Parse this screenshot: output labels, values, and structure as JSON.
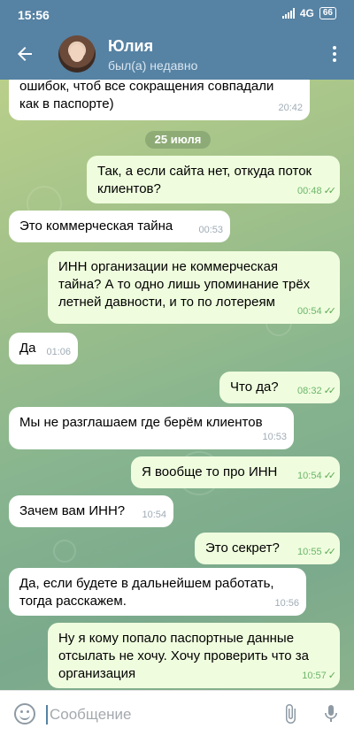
{
  "status_bar": {
    "time": "15:56",
    "network": "4G",
    "battery": "66"
  },
  "header": {
    "contact_name": "Юлия",
    "last_seen": "был(а) недавно"
  },
  "date_separator": "25 июля",
  "messages": [
    {
      "direction": "in",
      "text": "ошибок, чтоб все сокращения совпадали\nкак в паспорте)",
      "time": "20:42"
    },
    {
      "direction": "out",
      "text": "Так, а если сайта нет, откуда поток\nклиентов?",
      "time": "00:48",
      "read": true
    },
    {
      "direction": "in",
      "text": "Это коммерческая тайна",
      "time": "00:53"
    },
    {
      "direction": "out",
      "text": "ИНН организации не коммерческая\nтайна? А то одно лишь упоминание трёх\nлетней давности, и то по лотереям",
      "time": "00:54",
      "read": true
    },
    {
      "direction": "in",
      "text": "Да",
      "time": "01:06"
    },
    {
      "direction": "out",
      "text": "Что да?",
      "time": "08:32",
      "read": true
    },
    {
      "direction": "in",
      "text": "Мы не разглашаем где берём клиентов",
      "time": "10:53"
    },
    {
      "direction": "out",
      "text": "Я вообще то про ИНН",
      "time": "10:54",
      "read": true
    },
    {
      "direction": "in",
      "text": "Зачем вам ИНН?",
      "time": "10:54"
    },
    {
      "direction": "out",
      "text": "Это секрет?",
      "time": "10:55",
      "read": true
    },
    {
      "direction": "in",
      "text": "Да, если будете в дальнейшем работать,\nтогда расскажем.",
      "time": "10:56"
    },
    {
      "direction": "out",
      "text": "Ну я кому попало паспортные данные\nотсылать не хочу. Хочу проверить что за\nорганизация",
      "time": "10:57",
      "read": false
    }
  ],
  "input": {
    "placeholder": "Сообщение"
  },
  "colors": {
    "header": "#5682a3",
    "incoming_bubble": "#ffffff",
    "outgoing_bubble": "#effdde",
    "check": "#5ca853"
  },
  "icons": [
    "back-arrow-icon",
    "more-vertical-icon",
    "emoji-icon",
    "attach-icon",
    "microphone-icon",
    "double-check-icon",
    "single-check-icon"
  ]
}
